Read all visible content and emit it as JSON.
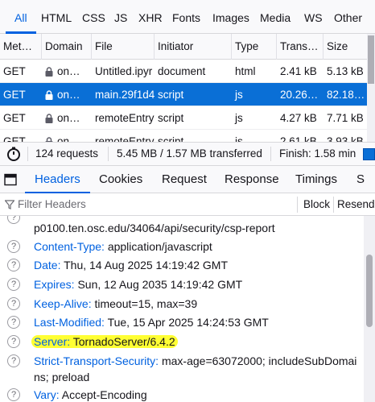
{
  "filter_tabs": [
    "All",
    "HTML",
    "CSS",
    "JS",
    "XHR",
    "Fonts",
    "Images",
    "Media",
    "WS",
    "Other"
  ],
  "table": {
    "columns": [
      "Met…",
      "Domain",
      "File",
      "Initiator",
      "Type",
      "Trans…",
      "Size"
    ],
    "rows": [
      {
        "method": "GET",
        "domain": "on…",
        "file": "Untitled.ipyr",
        "initiator": "document",
        "type": "html",
        "transferred": "2.41 kB",
        "size": "5.13 kB",
        "selected": false
      },
      {
        "method": "GET",
        "domain": "on…",
        "file": "main.29f1d4",
        "initiator": "script",
        "type": "js",
        "transferred": "20.26…",
        "size": "82.18…",
        "selected": true
      },
      {
        "method": "GET",
        "domain": "on…",
        "file": "remoteEntry",
        "initiator": "script",
        "type": "js",
        "transferred": "4.27 kB",
        "size": "7.71 kB",
        "selected": false
      },
      {
        "method": "GET",
        "domain": "on…",
        "file": "remoteEntry",
        "initiator": "script",
        "type": "js",
        "transferred": "2.61 kB",
        "size": "3.93 kB",
        "selected": false
      }
    ]
  },
  "summary": {
    "requests": "124 requests",
    "transferred": "5.45 MB / 1.57 MB transferred",
    "finish": "Finish: 1.58 min"
  },
  "detail_tabs": [
    "Headers",
    "Cookies",
    "Request",
    "Response",
    "Timings",
    "S"
  ],
  "headers_toolbar": {
    "filter_placeholder": "Filter Headers",
    "block_label": "Block",
    "resend_label": "Resend"
  },
  "headers": {
    "partial_top": "p0100.ten.osc.edu/34064/api/security/csp-report",
    "items": [
      {
        "name": "Content-Type:",
        "value": "application/javascript"
      },
      {
        "name": "Date:",
        "value": "Thu, 14 Aug 2025 14:19:42 GMT"
      },
      {
        "name": "Expires:",
        "value": "Sun, 12 Aug 2035 14:19:42 GMT"
      },
      {
        "name": "Keep-Alive:",
        "value": "timeout=15, max=39"
      },
      {
        "name": "Last-Modified:",
        "value": "Tue, 15 Apr 2025 14:24:53 GMT"
      },
      {
        "name": "Server:",
        "value": "TornadoServer/6.4.2",
        "highlighted": true
      },
      {
        "name": "Strict-Transport-Security:",
        "value": "max-age=63072000; includeSubDomai",
        "continuation": "ns; preload"
      },
      {
        "name": "Vary:",
        "value": "Accept-Encoding"
      }
    ]
  },
  "colors": {
    "accent": "#0061e0",
    "selected_row": "#0a6fd6",
    "highlight": "#ffff33"
  }
}
